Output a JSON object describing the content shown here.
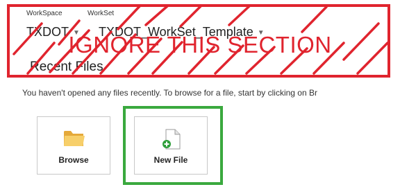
{
  "workspace": {
    "label": "WorkSpace",
    "value": "TXDOT"
  },
  "workset": {
    "label": "WorkSet",
    "value": "TXDOT_WorkSet_Template"
  },
  "recent": {
    "title": "Recent Files"
  },
  "annotation": {
    "ignore_text": "IGNORE THIS SECTION",
    "color": "#e0242e",
    "highlight_color": "#3aa93e"
  },
  "info": {
    "text": "You haven't opened any files recently.  To browse for a file, start by clicking on Br"
  },
  "tiles": [
    {
      "label": "Browse",
      "icon": "folder-icon"
    },
    {
      "label": "New File",
      "icon": "new-file-icon"
    }
  ]
}
